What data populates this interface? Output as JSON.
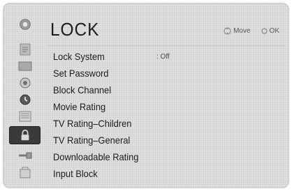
{
  "header": {
    "title": "LOCK",
    "hints": [
      {
        "icon": "dpad-icon",
        "label": "Move"
      },
      {
        "icon": "ok-circle-icon",
        "label": "OK"
      }
    ]
  },
  "sidebar": {
    "items": [
      {
        "icon": "setup-icon",
        "selected": false
      },
      {
        "icon": "tv-picture-icon",
        "selected": false
      },
      {
        "icon": "screen-icon",
        "selected": false
      },
      {
        "icon": "audio-icon",
        "selected": false
      },
      {
        "icon": "clock-icon",
        "selected": false
      },
      {
        "icon": "option-icon",
        "selected": false
      },
      {
        "icon": "lock-icon",
        "selected": true
      },
      {
        "icon": "input-icon",
        "selected": false
      },
      {
        "icon": "usb-icon",
        "selected": false
      }
    ]
  },
  "menu": {
    "items": [
      {
        "label": "Lock System",
        "value": ": Off"
      },
      {
        "label": "Set Password",
        "value": ""
      },
      {
        "label": "Block Channel",
        "value": ""
      },
      {
        "label": "Movie Rating",
        "value": ""
      },
      {
        "label": "TV Rating–Children",
        "value": ""
      },
      {
        "label": "TV Rating–General",
        "value": ""
      },
      {
        "label": "Downloadable Rating",
        "value": ""
      },
      {
        "label": "Input Block",
        "value": ""
      }
    ]
  },
  "colors": {
    "panel": "#dedede",
    "selected_icon_bg": "#3a3a3a",
    "text": "#1c1c1c"
  }
}
